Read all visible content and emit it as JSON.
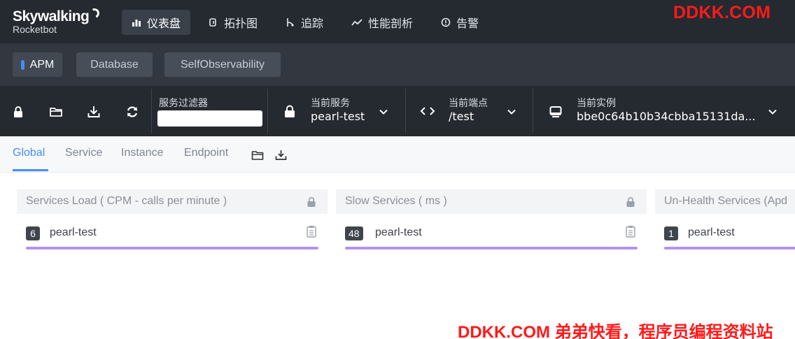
{
  "logo": {
    "name": "Skywalking",
    "sub": "Rocketbot"
  },
  "nav": [
    {
      "label": "仪表盘",
      "icon": "chart-bar-icon",
      "active": true
    },
    {
      "label": "拓扑图",
      "icon": "topology-icon",
      "active": false
    },
    {
      "label": "追踪",
      "icon": "trace-icon",
      "active": false
    },
    {
      "label": "性能剖析",
      "icon": "trend-icon",
      "active": false
    },
    {
      "label": "告警",
      "icon": "alert-icon",
      "active": false
    }
  ],
  "watermark_top": "DDKK.COM",
  "layers": [
    {
      "label": "APM",
      "active": true
    },
    {
      "label": "Database",
      "active": false
    },
    {
      "label": "SelfObservability",
      "active": false
    }
  ],
  "toolbar": {
    "filter_label": "服务过滤器",
    "filter_value": "",
    "service": {
      "label": "当前服务",
      "value": "pearl-test"
    },
    "endpoint": {
      "label": "当前端点",
      "value": "/test"
    },
    "instance": {
      "label": "当前实例",
      "value": "bbe0c64b10b34cbba15131da..."
    }
  },
  "dash_tabs": [
    {
      "label": "Global",
      "active": true
    },
    {
      "label": "Service",
      "active": false
    },
    {
      "label": "Instance",
      "active": false
    },
    {
      "label": "Endpoint",
      "active": false
    }
  ],
  "panels": [
    {
      "title": "Services Load ( CPM - calls per minute )",
      "rows": [
        {
          "value": "6",
          "name": "pearl-test",
          "fraction": 1.0
        }
      ]
    },
    {
      "title": "Slow Services ( ms )",
      "rows": [
        {
          "value": "48",
          "name": "pearl-test",
          "fraction": 1.0
        }
      ]
    },
    {
      "title": "Un-Health Services (Apd",
      "rows": [
        {
          "value": "1",
          "name": "pearl-test",
          "fraction": 1.0
        }
      ]
    }
  ],
  "watermark_bottom": "DDKK.COM 弟弟快看，程序员编程资料站",
  "colors": {
    "accent": "#448dfe",
    "bar": "#b394ee",
    "nav_bg": "#252a31",
    "watermark": "#ff1a1a"
  }
}
